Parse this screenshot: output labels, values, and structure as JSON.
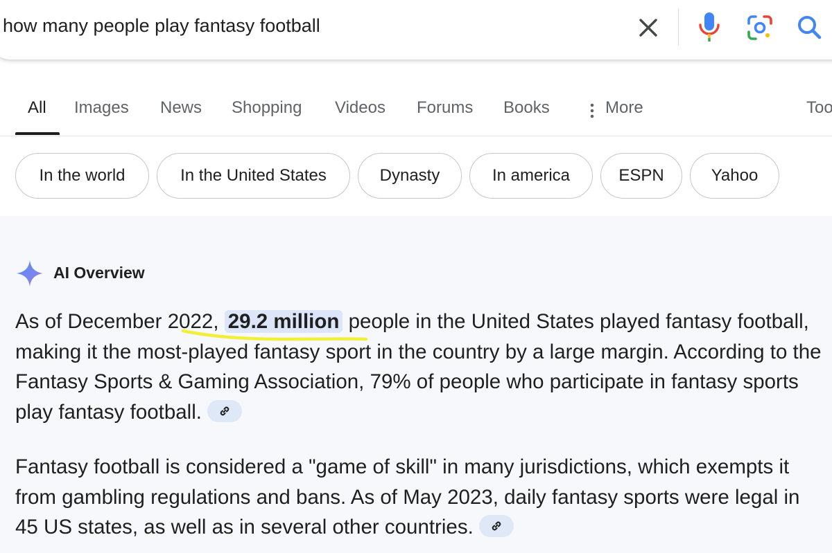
{
  "search": {
    "query": "how many people play fantasy football"
  },
  "icons": {
    "clear": "close-icon",
    "voice": "microphone-icon",
    "lens": "camera-lens-icon",
    "search": "search-icon",
    "more": "vertical-dots-icon",
    "ai": "sparkle-icon",
    "link": "link-icon"
  },
  "tabs": [
    {
      "label": "All",
      "active": true
    },
    {
      "label": "Images"
    },
    {
      "label": "News"
    },
    {
      "label": "Shopping"
    },
    {
      "label": "Videos"
    },
    {
      "label": "Forums"
    },
    {
      "label": "Books"
    },
    {
      "label": "More"
    },
    {
      "label": "Too"
    }
  ],
  "chips": [
    "In the world",
    "In the United States",
    "Dynasty",
    "In america",
    "ESPN",
    "Yahoo"
  ],
  "ai_overview": {
    "title": "AI Overview",
    "p1": {
      "before_year": "As of December ",
      "year": "2022",
      "after_year": ", ",
      "highlight": "29.2 million",
      "rest": " people in the United States played fantasy football, making it the most-played fantasy sport in the country by a large margin. According to the Fantasy Sports & Gaming Association, 79% of people who participate in fantasy sports play fantasy football."
    },
    "p2": "Fantasy football is considered a \"game of skill\" in many jurisdictions, which exempts it from gambling regulations and bans. As of May 2023, daily fantasy sports were legal in 45 US states, as well as in several other countries."
  },
  "colors": {
    "highlight_bg": "#dce6f8",
    "panel_bg": "#f6f8fc",
    "yellow_underline": "#f2ef3a",
    "google_blue": "#4285f4",
    "google_red": "#ea4335",
    "google_yellow": "#fbbc04",
    "google_green": "#34a853"
  }
}
